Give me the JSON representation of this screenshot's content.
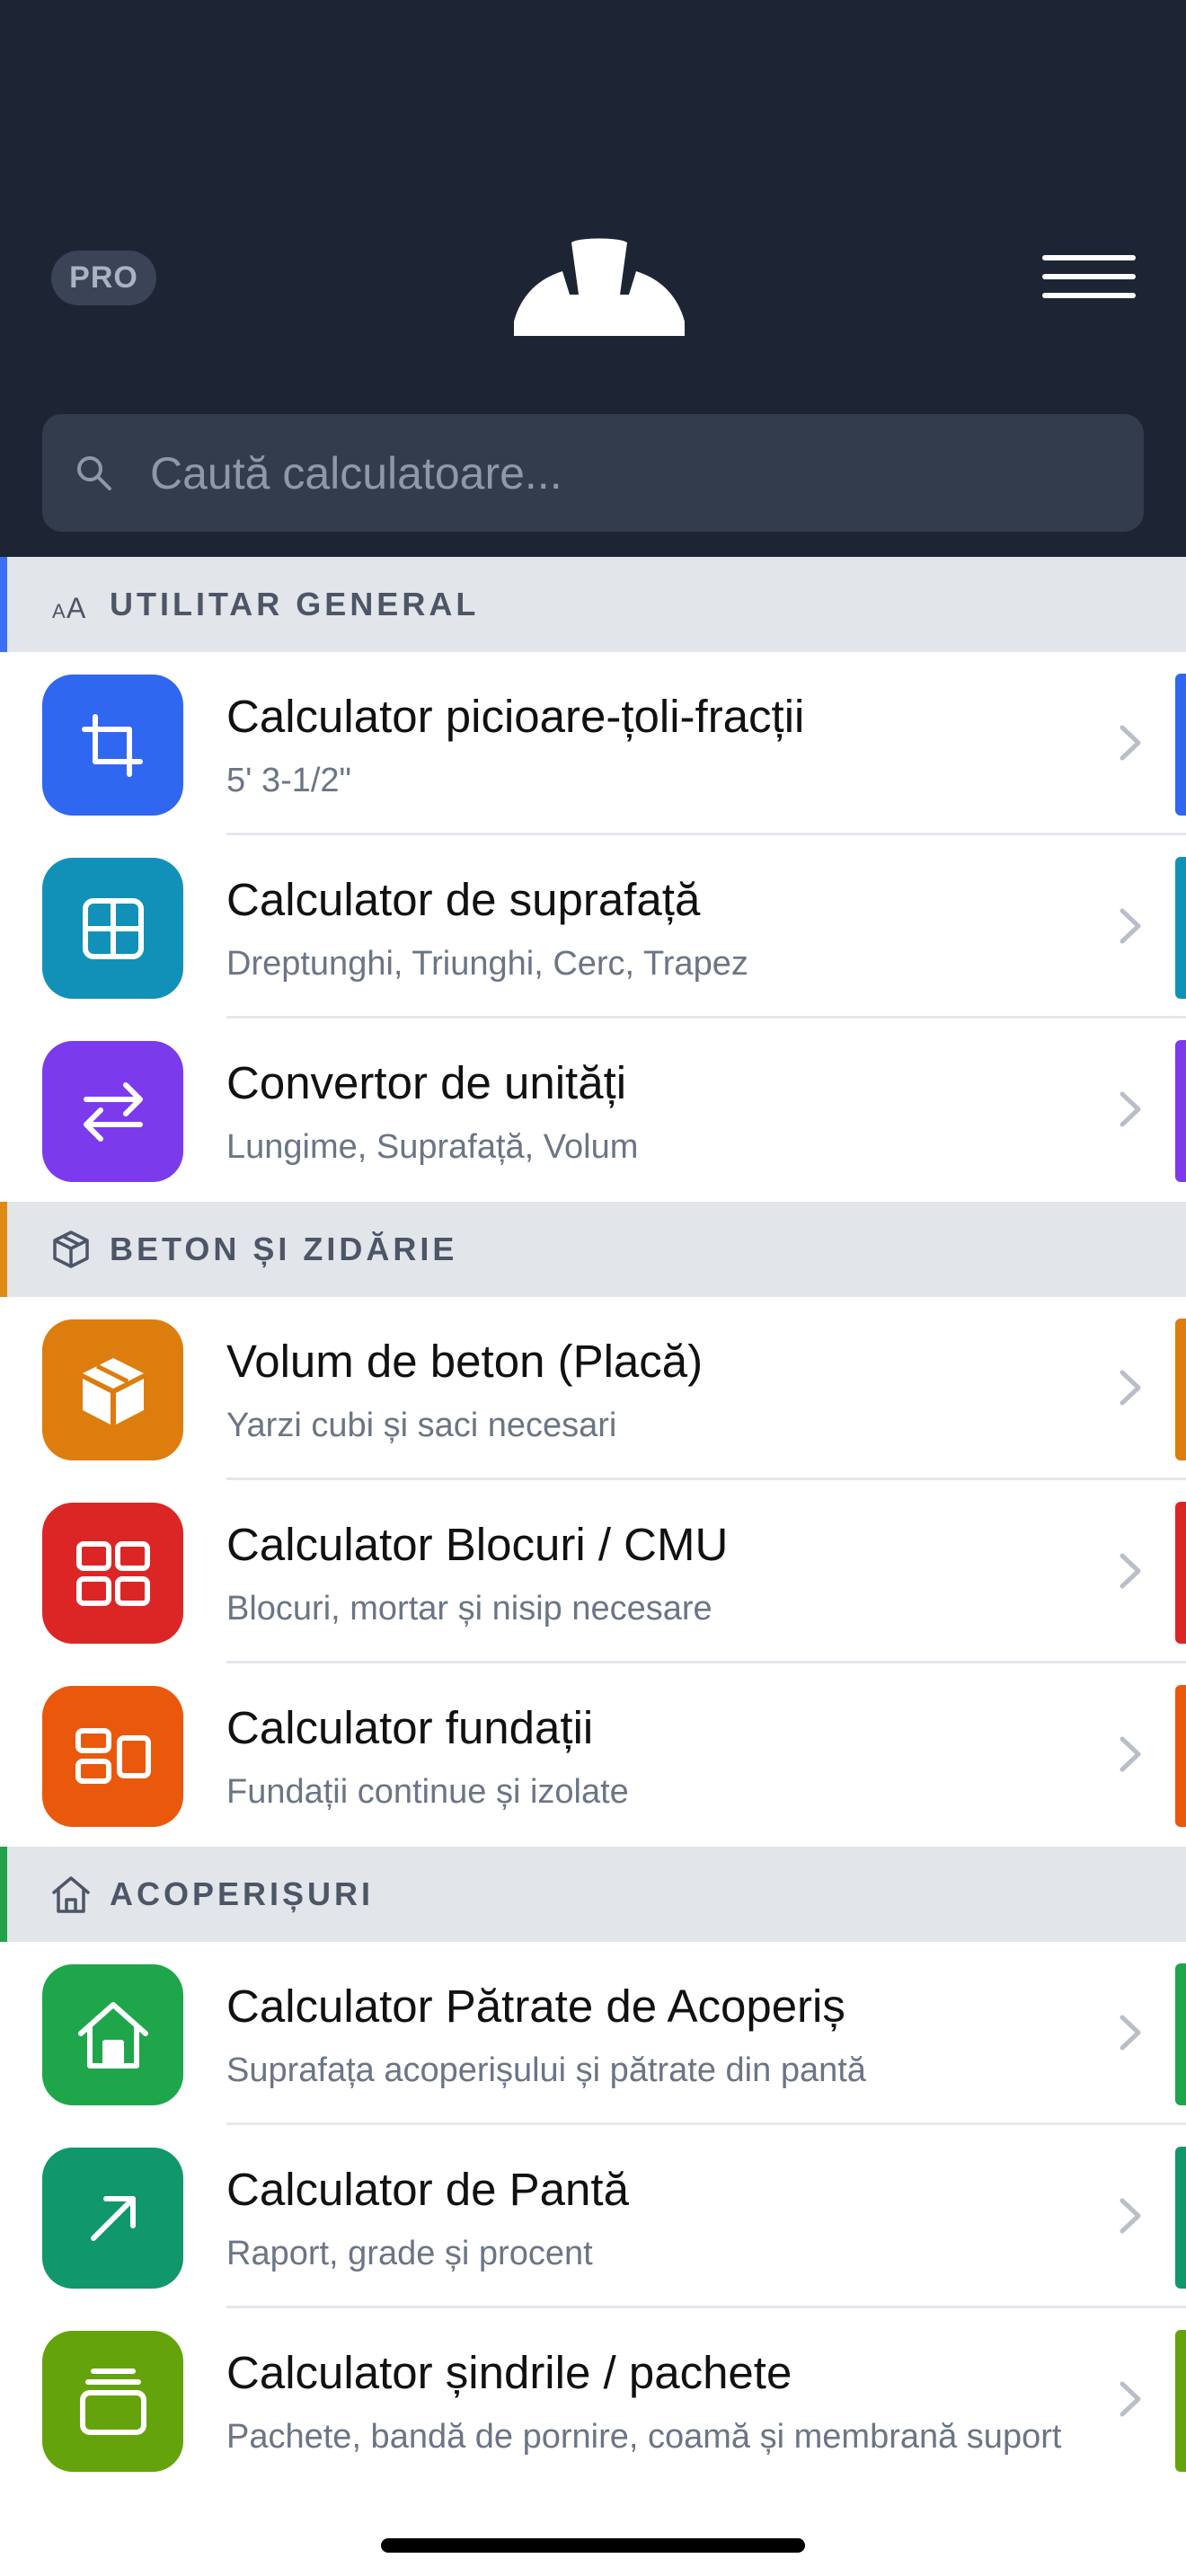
{
  "header": {
    "pro_label": "PRO",
    "search_placeholder": "Caută calculatoare..."
  },
  "sections": [
    {
      "title": "UTILITAR GENERAL",
      "icon": "text-size-icon",
      "accent": "#3b6ff5",
      "items": [
        {
          "title": "Calculator picioare-țoli-fracții",
          "subtitle": "5' 3-1/2\"",
          "icon": "crop-icon",
          "color": "#2f67f0"
        },
        {
          "title": "Calculator de suprafață",
          "subtitle": "Dreptunghi, Triunghi, Cerc, Trapez",
          "icon": "grid-square-icon",
          "color": "#1291b8"
        },
        {
          "title": "Convertor de unități",
          "subtitle": "Lungime, Suprafață, Volum",
          "icon": "swap-arrows-icon",
          "color": "#7c3aed"
        }
      ]
    },
    {
      "title": "BETON ȘI ZIDĂRIE",
      "icon": "box-icon",
      "accent": "#e08a12",
      "items": [
        {
          "title": "Volum de beton (Placă)",
          "subtitle": "Yarzi cubi și saci necesari",
          "icon": "cube-icon",
          "color": "#dd7d0e"
        },
        {
          "title": "Calculator Blocuri / CMU",
          "subtitle": "Blocuri, mortar și nisip necesare",
          "icon": "blocks-icon",
          "color": "#dc2626"
        },
        {
          "title": "Calculator fundații",
          "subtitle": "Fundații continue și izolate",
          "icon": "foundation-icon",
          "color": "#ea580c"
        }
      ]
    },
    {
      "title": "ACOPERIȘURI",
      "icon": "house-outline-icon",
      "accent": "#22a34a",
      "items": [
        {
          "title": "Calculator Pătrate de Acoperiș",
          "subtitle": "Suprafața acoperișului și pătrate din pantă",
          "icon": "house-icon",
          "color": "#1fa64a"
        },
        {
          "title": "Calculator de Pantă",
          "subtitle": "Raport, grade și procent",
          "icon": "arrow-up-right-icon",
          "color": "#10976b"
        },
        {
          "title": "Calculator șindrile / pachete",
          "subtitle": "Pachete, bandă de pornire, coamă și membrană suport",
          "icon": "stack-icon",
          "color": "#65a30d"
        }
      ]
    }
  ]
}
